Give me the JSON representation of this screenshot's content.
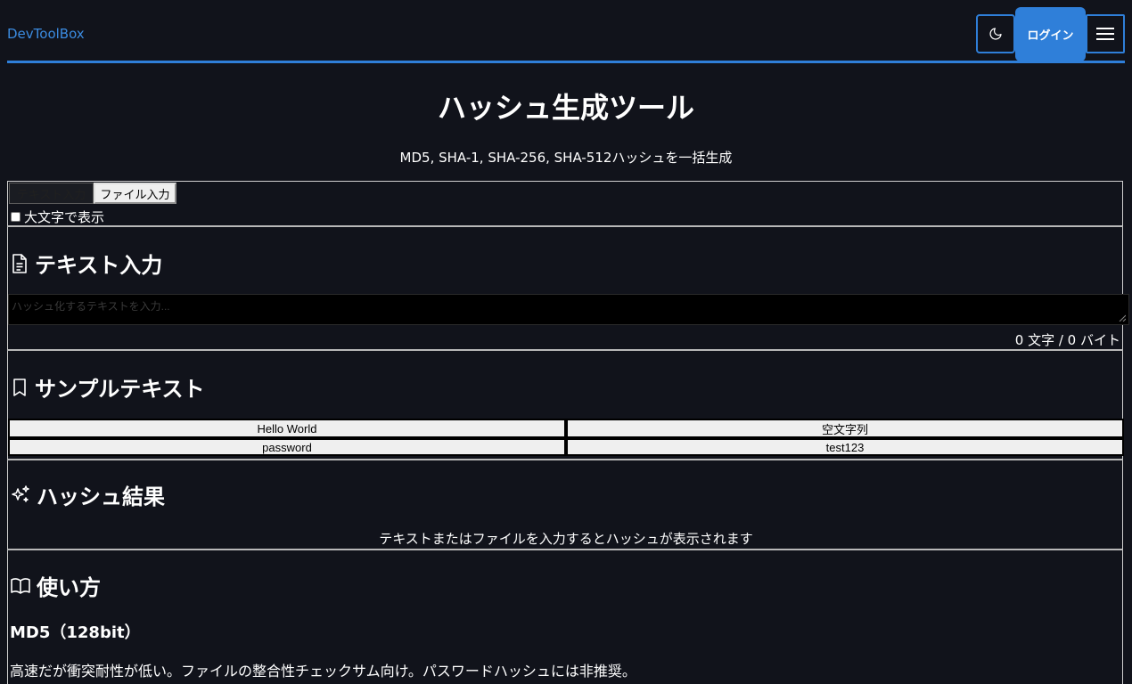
{
  "header": {
    "brand": "DevToolBox",
    "login_label": "ログイン",
    "theme_icon": "moon-icon",
    "menu_icon": "hamburger-menu-icon",
    "accent_color": "#2f7fd9"
  },
  "page": {
    "title": "ハッシュ生成ツール",
    "subtitle": "MD5, SHA-1, SHA-256, SHA-512ハッシュを一括生成"
  },
  "input_modes": {
    "tabs": [
      {
        "label": "テキスト入力",
        "active": true
      },
      {
        "label": "ファイル入力",
        "active": false
      }
    ],
    "uppercase_label": "大文字で表示",
    "uppercase_checked": false
  },
  "text_input": {
    "heading": "テキスト入力",
    "icon": "document-icon",
    "placeholder": "ハッシュ化するテキストを入力...",
    "value": "",
    "count": "0 文字 / 0 バイト"
  },
  "samples": {
    "heading": "サンプルテキスト",
    "icon": "bookmark-icon",
    "items": [
      "Hello World",
      "空文字列",
      "password",
      "test123"
    ]
  },
  "results": {
    "heading": "ハッシュ結果",
    "icon": "sparkles-icon",
    "empty_message": "テキストまたはファイルを入力するとハッシュが表示されます"
  },
  "usage": {
    "heading": "使い方",
    "icon": "open-book-icon",
    "md5_title": "MD5（128bit）",
    "md5_desc": "高速だが衝突耐性が低い。ファイルの整合性チェックサム向け。パスワードハッシュには非推奨。"
  }
}
